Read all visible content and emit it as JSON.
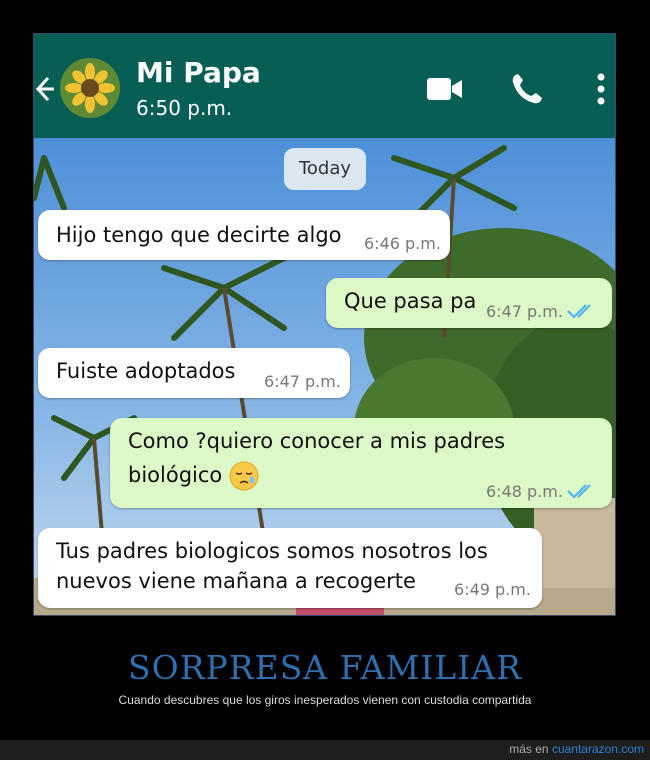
{
  "header": {
    "contact_name": "Mi Papa",
    "status": "6:50 p.m.",
    "icons": [
      "back-arrow-icon",
      "video-call-icon",
      "phone-icon",
      "more-options-icon"
    ],
    "color": "#075E54"
  },
  "chat": {
    "date_chip": "Today",
    "messages": [
      {
        "direction": "in",
        "text": "Hijo tengo que decirte algo",
        "time": "6:46 p.m."
      },
      {
        "direction": "out",
        "text": "Que pasa pa",
        "time": "6:47 p.m.",
        "status": "read"
      },
      {
        "direction": "in",
        "text": "Fuiste adoptados",
        "time": "6:47 p.m."
      },
      {
        "direction": "out",
        "line1": "Como ?quiero conocer a mis padres",
        "line2": "biológico",
        "emoji": "sleepy-face-emoji",
        "time": "6:48 p.m.",
        "status": "read"
      },
      {
        "direction": "in",
        "line1": "Tus padres biologicos somos nosotros los",
        "line2": "nuevos viene mañana a recogerte",
        "time": "6:49 p.m."
      }
    ],
    "colors": {
      "incoming": "#ffffff",
      "outgoing": "#dcf8c6",
      "ticks": "#4fb3f6"
    }
  },
  "caption": {
    "title": "SORPRESA FAMILIAR",
    "subtitle": "Cuando descubres que los giros inesperados vienen con custodia compartida"
  },
  "footer": {
    "prefix": "más en ",
    "site": "cuantarazon.com"
  }
}
